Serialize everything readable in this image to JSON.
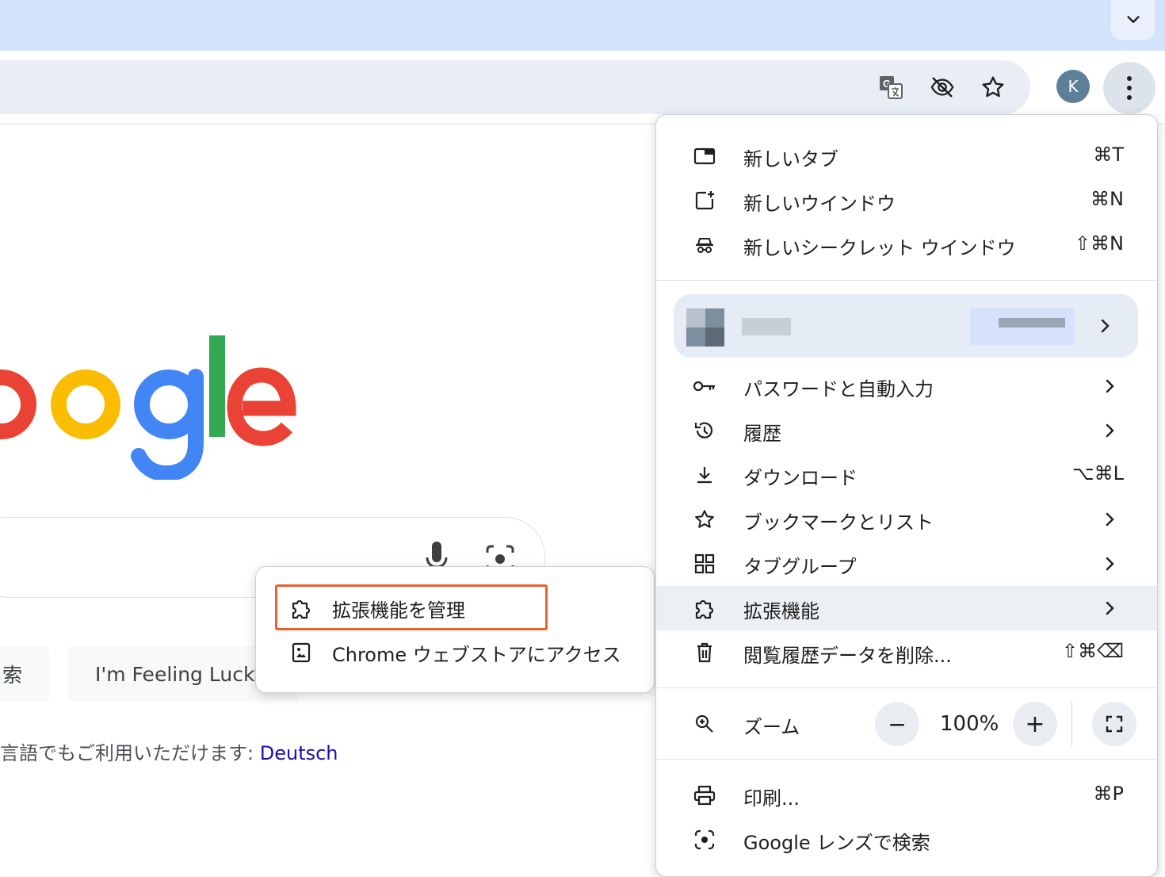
{
  "browser": {
    "avatar_letter": "K"
  },
  "page": {
    "feeling_lucky": "I'm Feeling Lucky",
    "search_button_fragment": "索",
    "language_text": "言語でもご利用いただけます:",
    "language_link": "Deutsch"
  },
  "submenu": {
    "items": [
      {
        "label": "拡張機能を管理",
        "icon": "puzzle-icon"
      },
      {
        "label": "Chrome ウェブストアにアクセス",
        "icon": "webstore-icon"
      }
    ]
  },
  "menu": {
    "new_tab": {
      "label": "新しいタブ",
      "shortcut": "⌘T"
    },
    "new_window": {
      "label": "新しいウインドウ",
      "shortcut": "⌘N"
    },
    "incognito": {
      "label": "新しいシークレット ウインドウ",
      "shortcut": "⇧⌘N"
    },
    "passwords": {
      "label": "パスワードと自動入力"
    },
    "history": {
      "label": "履歴"
    },
    "downloads": {
      "label": "ダウンロード",
      "shortcut": "⌥⌘L"
    },
    "bookmarks": {
      "label": "ブックマークとリスト"
    },
    "tab_groups": {
      "label": "タブグループ"
    },
    "extensions": {
      "label": "拡張機能"
    },
    "clear_data": {
      "label": "閲覧履歴データを削除...",
      "shortcut": "⇧⌘⌫"
    },
    "zoom": {
      "label": "ズーム",
      "value": "100%",
      "minus": "−",
      "plus": "+"
    },
    "print": {
      "label": "印刷...",
      "shortcut": "⌘P"
    },
    "lens": {
      "label": "Google レンズで検索"
    }
  },
  "colors": {
    "tabstrip": "#d3e3fd",
    "highlight": "#e8622c",
    "link": "#1a0dab"
  }
}
